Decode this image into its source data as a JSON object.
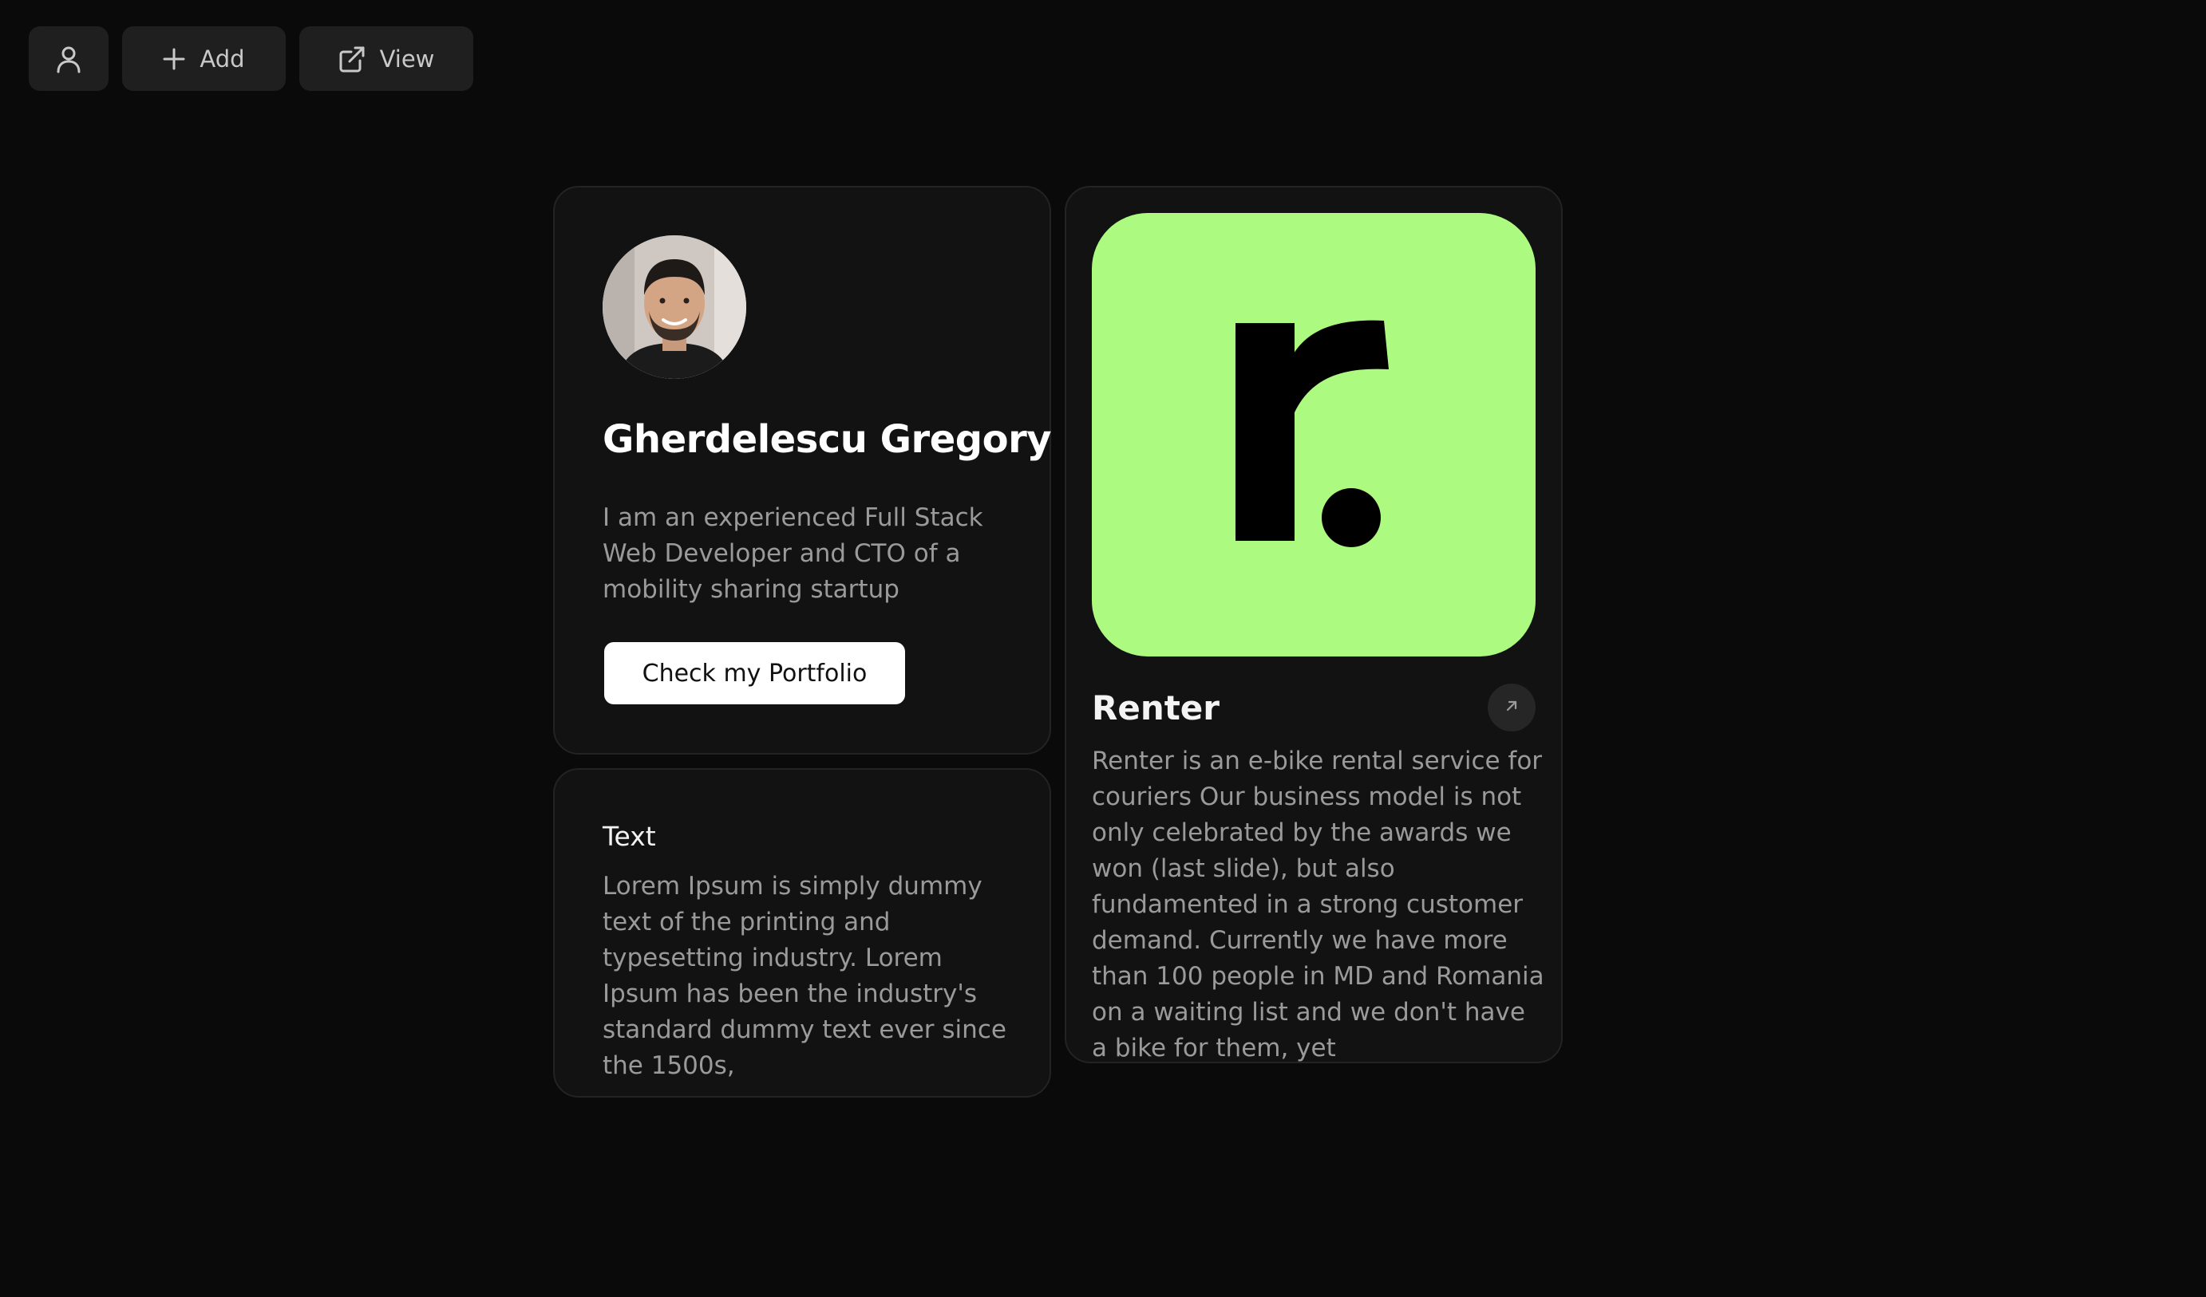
{
  "toolbar": {
    "add_label": "Add",
    "view_label": "View"
  },
  "profile": {
    "name": "Gherdelescu Gregory",
    "bio": "I am an experienced Full Stack Web Developer and CTO of a mobility sharing startup",
    "cta_label": "Check my Portfolio"
  },
  "text_card": {
    "title": "Text",
    "body": "Lorem Ipsum is simply dummy text of the printing and typesetting industry. Lorem Ipsum has been the industry's standard dummy text ever since the 1500s,"
  },
  "project": {
    "logo_color": "#adfa80",
    "title": "Renter",
    "description": "Renter is an e-bike rental service for couriers Our business model is not only celebrated by the awards we won (last slide), but also fundamented in a strong customer demand. Currently we have more than 100 people in MD and Romania on a waiting list and we don't have a bike for them, yet"
  },
  "icons": {
    "toolbar_user": "user-icon",
    "toolbar_add": "plus-icon",
    "toolbar_view": "external-link-icon",
    "project_arrow": "arrow-up-right-icon"
  }
}
